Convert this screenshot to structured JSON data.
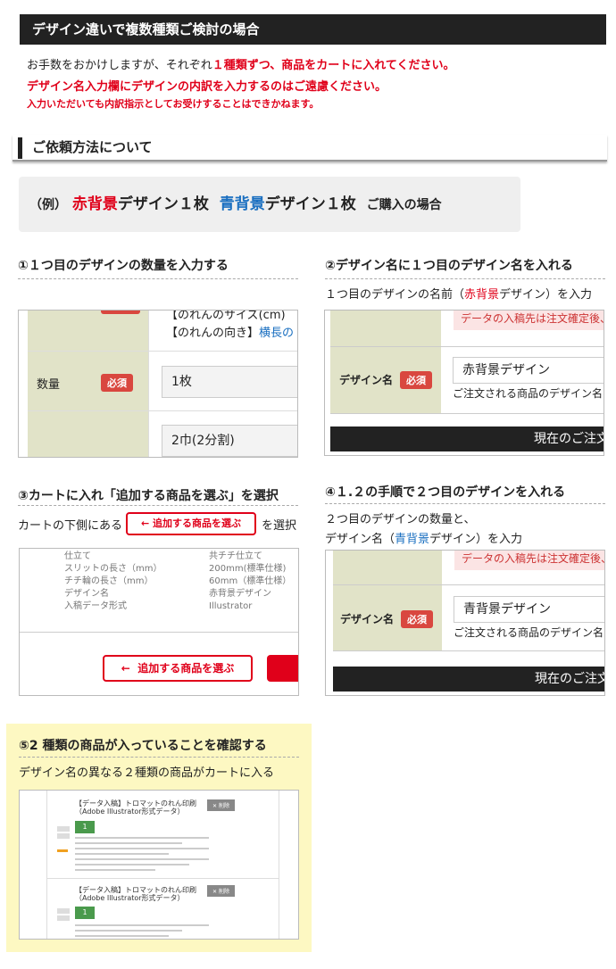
{
  "section1": {
    "title": "デザイン違いで複数種類ご検討の場合",
    "line1_pre": "お手数をおかけしますが、それぞれ",
    "line1_red": "１種類ずつ、商品をカートに入れてください。",
    "line2": "デザイン名入力欄にデザインの内訳を入力するのはご遠慮ください。",
    "line3": "入力いただいても内訳指示としてお受けすることはできかねます。"
  },
  "section2": {
    "title": "ご依頼方法について",
    "example": {
      "prefix": "（例）",
      "red_word": "赤背景",
      "mid1": "デザイン１枚",
      "blue_word": "青背景",
      "mid2": "デザイン１枚",
      "suffix": "ご購入の場合"
    }
  },
  "step1": {
    "heading": "①１つ目のデザインの数量を入力する",
    "cut_text1": "【のれんのサイズ(cm)",
    "cut_text2": "【のれんの向き】",
    "cut_link": "横長の",
    "qty_label": "数量",
    "required": "必須",
    "qty_value": "1枚",
    "split_value": "2巾(2分割)"
  },
  "step2": {
    "heading": "②デザイン名に１つ目のデザイン名を入れる",
    "note_pre": "１つ目のデザインの名前（",
    "note_red": "赤背景",
    "note_post": "デザイン）を入力",
    "pink_text": "データの入稿先は注文確定後、目",
    "name_label": "デザイン名",
    "required": "必須",
    "name_value": "赤背景デザイン",
    "helper": "ご注文される商品のデザイン名(",
    "bar_text": "現在のご注文"
  },
  "step3": {
    "heading": "③カートに入れ「追加する商品を選ぶ」を選択",
    "note_pre": "カートの下側にある",
    "note_btn": "追加する商品を選ぶ",
    "note_post": "を選択",
    "rows": [
      {
        "k": "仕立て",
        "v": "共チチ仕立て"
      },
      {
        "k": "スリットの長さ（mm）",
        "v": "200mm(標準仕様)"
      },
      {
        "k": "チチ輪の長さ（mm）",
        "v": "60mm（標準仕様）"
      },
      {
        "k": "デザイン名",
        "v": "赤背景デザイン"
      },
      {
        "k": "入稿データ形式",
        "v": "Illustrator"
      }
    ],
    "add_button": "追加する商品を選ぶ"
  },
  "step4": {
    "heading": "④１.２の手順で２つ目のデザインを入れる",
    "note1": "２つ目のデザインの数量と、",
    "note2_pre": "デザイン名（",
    "note2_blue": "青背景",
    "note2_post": "デザイン）を入力",
    "pink_text": "データの入稿先は注文確定後、目",
    "name_label": "デザイン名",
    "required": "必須",
    "name_value": "青背景デザイン",
    "helper": "ご注文される商品のデザイン名(",
    "bar_text": "現在のご注文"
  },
  "step5": {
    "heading": "⑤2 種類の商品が入っていることを確認する",
    "note": "デザイン名の異なる２種類の商品がカートに入る",
    "items": [
      {
        "title": "【データ入稿】トロマットのれん印刷（Adobe Illustrator形式データ）",
        "qty": "1",
        "delete": "削除"
      },
      {
        "title": "【データ入稿】トロマットのれん印刷（Adobe Illustrator形式データ）",
        "qty": "1",
        "delete": "削除"
      }
    ]
  }
}
